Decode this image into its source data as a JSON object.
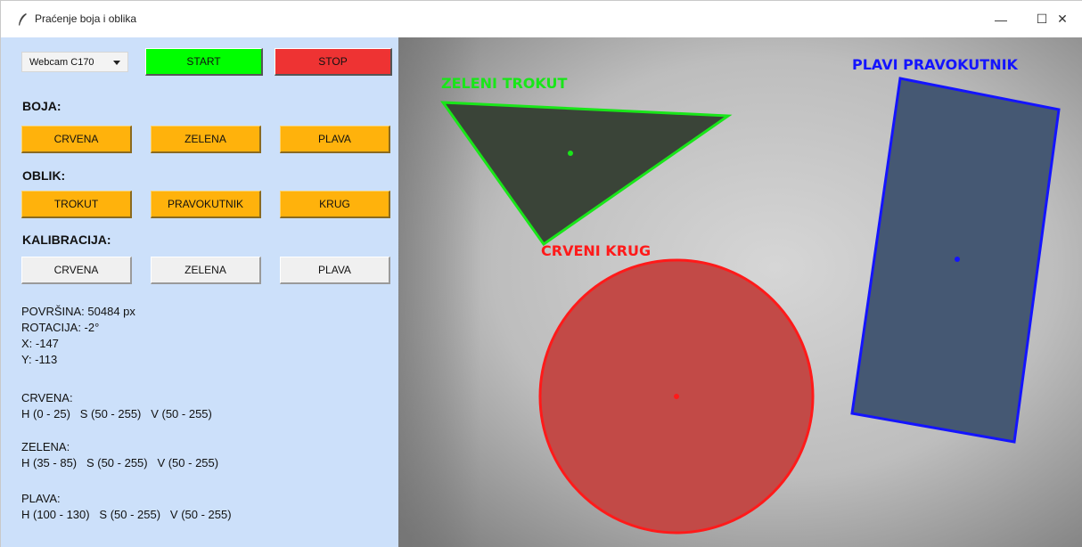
{
  "window": {
    "title": "Praćenje boja i oblika",
    "minimize_glyph": "—",
    "maximize_glyph": "☐",
    "close_glyph": "✕"
  },
  "controls": {
    "camera_select": "Webcam C170",
    "start_label": "START",
    "stop_label": "STOP"
  },
  "color_section": {
    "heading": "BOJA:",
    "buttons": [
      "CRVENA",
      "ZELENA",
      "PLAVA"
    ]
  },
  "shape_section": {
    "heading": "OBLIK:",
    "buttons": [
      "TROKUT",
      "PRAVOKUTNIK",
      "KRUG"
    ]
  },
  "calibration_section": {
    "heading": "KALIBRACIJA:",
    "buttons": [
      "CRVENA",
      "ZELENA",
      "PLAVA"
    ]
  },
  "measurements": {
    "area": "POVRŠINA: 50484 px",
    "rotation": "ROTACIJA: -2°",
    "x": "X: -147",
    "y": "Y: -113"
  },
  "ranges": {
    "red_title": "CRVENA:",
    "red_values": "H (0 - 25)   S (50 - 255)   V (50 - 255)",
    "green_title": "ZELENA:",
    "green_values": "H (35 - 85)   S (50 - 255)   V (50 - 255)",
    "blue_title": "PLAVA:",
    "blue_values": "H (100 - 130)   S (50 - 255)   V (50 - 255)"
  },
  "camera_labels": {
    "triangle": "ZELENI TROKUT",
    "circle": "CRVENI KRUG",
    "rectangle": "PLAVI PRAVOKUTNIK"
  },
  "colors": {
    "panel_bg": "#cce0fa",
    "start": "#00ff00",
    "stop": "#ee3333",
    "orange_button": "#ffb20c",
    "green_outline": "#19e619",
    "red_outline": "#ff1a1a",
    "blue_outline": "#1414ff"
  }
}
